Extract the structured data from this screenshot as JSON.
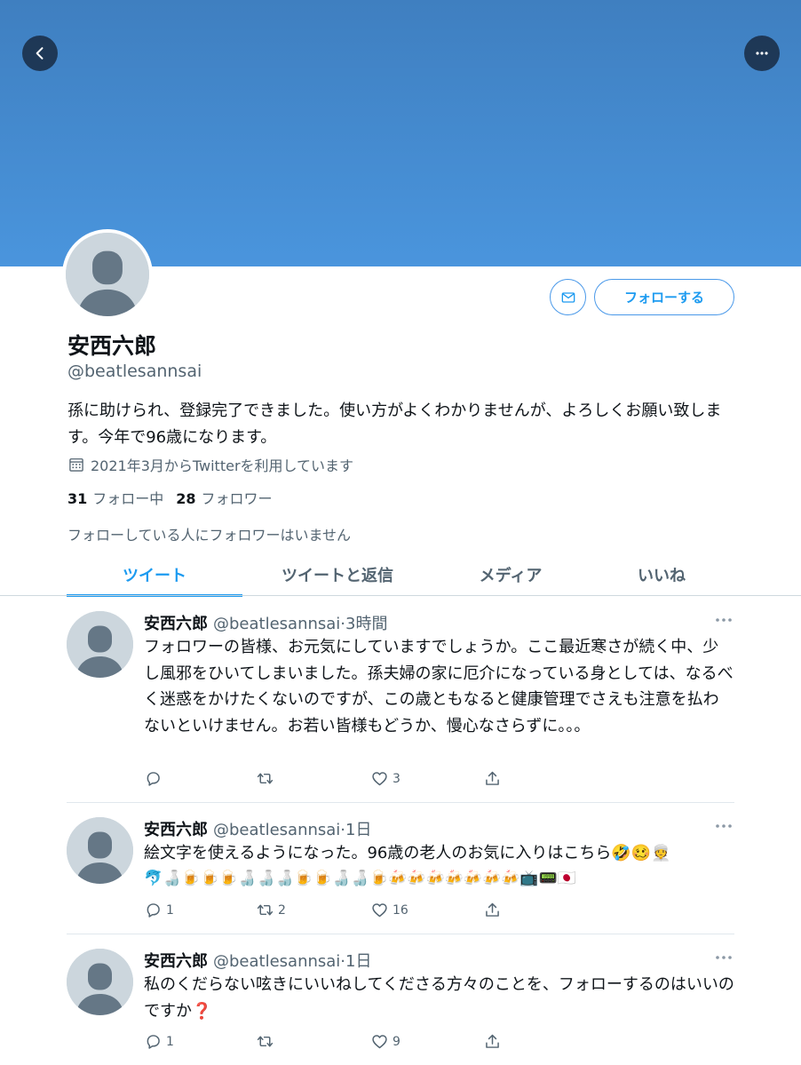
{
  "header": {
    "back_icon": "chevron-left-icon",
    "more_icon": "more-dots-icon"
  },
  "profile": {
    "display_name": "安西六郎",
    "handle": "@beatlesannsai",
    "bio": "孫に助けられ、登録完了できました。使い方がよくわかりませんが、よろしくお願い致します。今年で96歳になります。",
    "joined": "2021年3月からTwitterを利用しています",
    "following_count": "31",
    "following_label": "フォロー中",
    "followers_count": "28",
    "followers_label": "フォロワー",
    "known_followers": "フォローしている人にフォロワーはいません",
    "follow_button": "フォローする",
    "dm_icon": "envelope-icon"
  },
  "tabs": [
    {
      "label": "ツイート",
      "active": true
    },
    {
      "label": "ツイートと返信",
      "active": false
    },
    {
      "label": "メディア",
      "active": false
    },
    {
      "label": "いいね",
      "active": false
    }
  ],
  "tweets": [
    {
      "name": "安西六郎",
      "handle_time": "@beatlesannsai·3時間",
      "text": "フォロワーの皆様、お元気にしていますでしょうか。ここ最近寒さが続く中、少し風邪をひいてしまいました。孫夫婦の家に厄介になっている身としては、なるべく迷惑をかけたくないのですが、この歳ともなると健康管理でさえも注意を払わないといけません。お若い皆様もどうか、慢心なさらずに。。。",
      "replies": "",
      "retweets": "",
      "likes": "3"
    },
    {
      "name": "安西六郎",
      "handle_time": "@beatlesannsai·1日",
      "text": "絵文字を使えるようになった。96歳の老人のお気に入りはこちら🤣🥴👳",
      "emoji": "🐬🍶🍺🍺🍺🍶🍶🍶🍺🍺🍶🍶🍺🍻🍻🍻🍻🍻🍻🍻📺📟🇯🇵",
      "replies": "1",
      "retweets": "2",
      "likes": "16"
    },
    {
      "name": "安西六郎",
      "handle_time": "@beatlesannsai·1日",
      "text": "私のくだらない呟きにいいねしてくださる方々のことを、フォローするのはいいのですか❓",
      "replies": "1",
      "retweets": "",
      "likes": "9"
    }
  ]
}
